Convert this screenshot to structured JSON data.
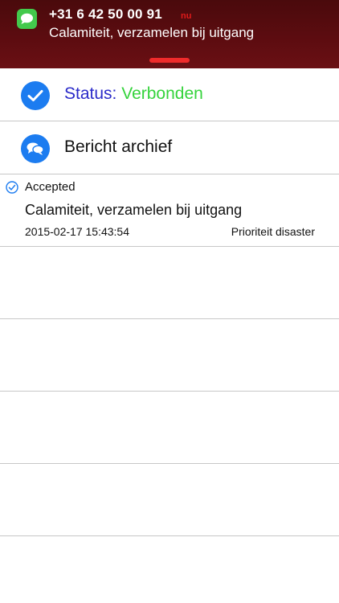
{
  "notification": {
    "sender": "+31 6 42 50 00 91",
    "time": "nu",
    "message": "Calamiteit, verzamelen bij uitgang",
    "icon": "messages-app-icon"
  },
  "status": {
    "label": "Status:",
    "value": "Verbonden",
    "icon": "checkmark-icon"
  },
  "archive": {
    "label": "Bericht archief",
    "icon": "chat-bubbles-icon"
  },
  "messages": [
    {
      "state": "Accepted",
      "text": "Calamiteit, verzamelen bij uitgang",
      "date": "2015-02-17 15:43:54",
      "priority": "Prioriteit disaster"
    }
  ],
  "colors": {
    "banner": "#5c0c10",
    "accent_blue": "#1c7cf0",
    "status_label": "#2b2bc9",
    "status_value": "#35d33c",
    "notification_time": "#e01b1b"
  }
}
